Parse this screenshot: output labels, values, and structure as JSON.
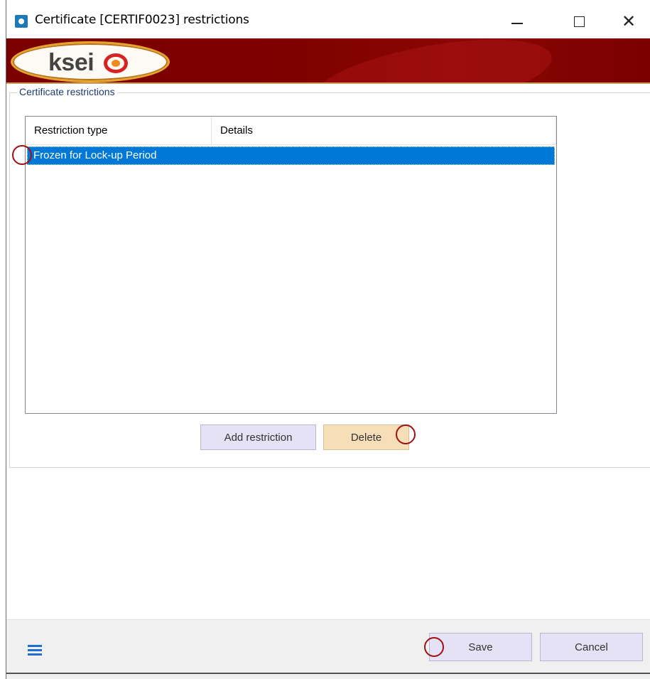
{
  "window": {
    "title": "Certificate [CERTIF0023] restrictions",
    "minimize_icon": "minimize-icon",
    "maximize_icon": "maximize-icon",
    "close_icon": "close-icon",
    "close_glyph": "✕"
  },
  "banner": {
    "logo_text": "ksei",
    "logo_icon": "ksei-logo-mark"
  },
  "group": {
    "legend": "Certificate restrictions"
  },
  "listview": {
    "columns": [
      "Restriction type",
      "Details"
    ],
    "rows": [
      {
        "restriction_type": "Frozen for Lock-up Period",
        "details": "",
        "selected": true
      }
    ],
    "selection_color": "#0078d7"
  },
  "buttons": {
    "add_restriction": "Add restriction",
    "delete": "Delete",
    "save": "Save",
    "cancel": "Cancel"
  },
  "footer": {
    "menu_icon": "hamburger-menu-icon",
    "accent_color": "#1f6fd0"
  },
  "colors": {
    "banner": "#800000",
    "logo_ring": "#e7a42b",
    "annotation_circle": "#a01010",
    "delete_button": "#f5deb8",
    "default_button": "#e4e2f4"
  }
}
